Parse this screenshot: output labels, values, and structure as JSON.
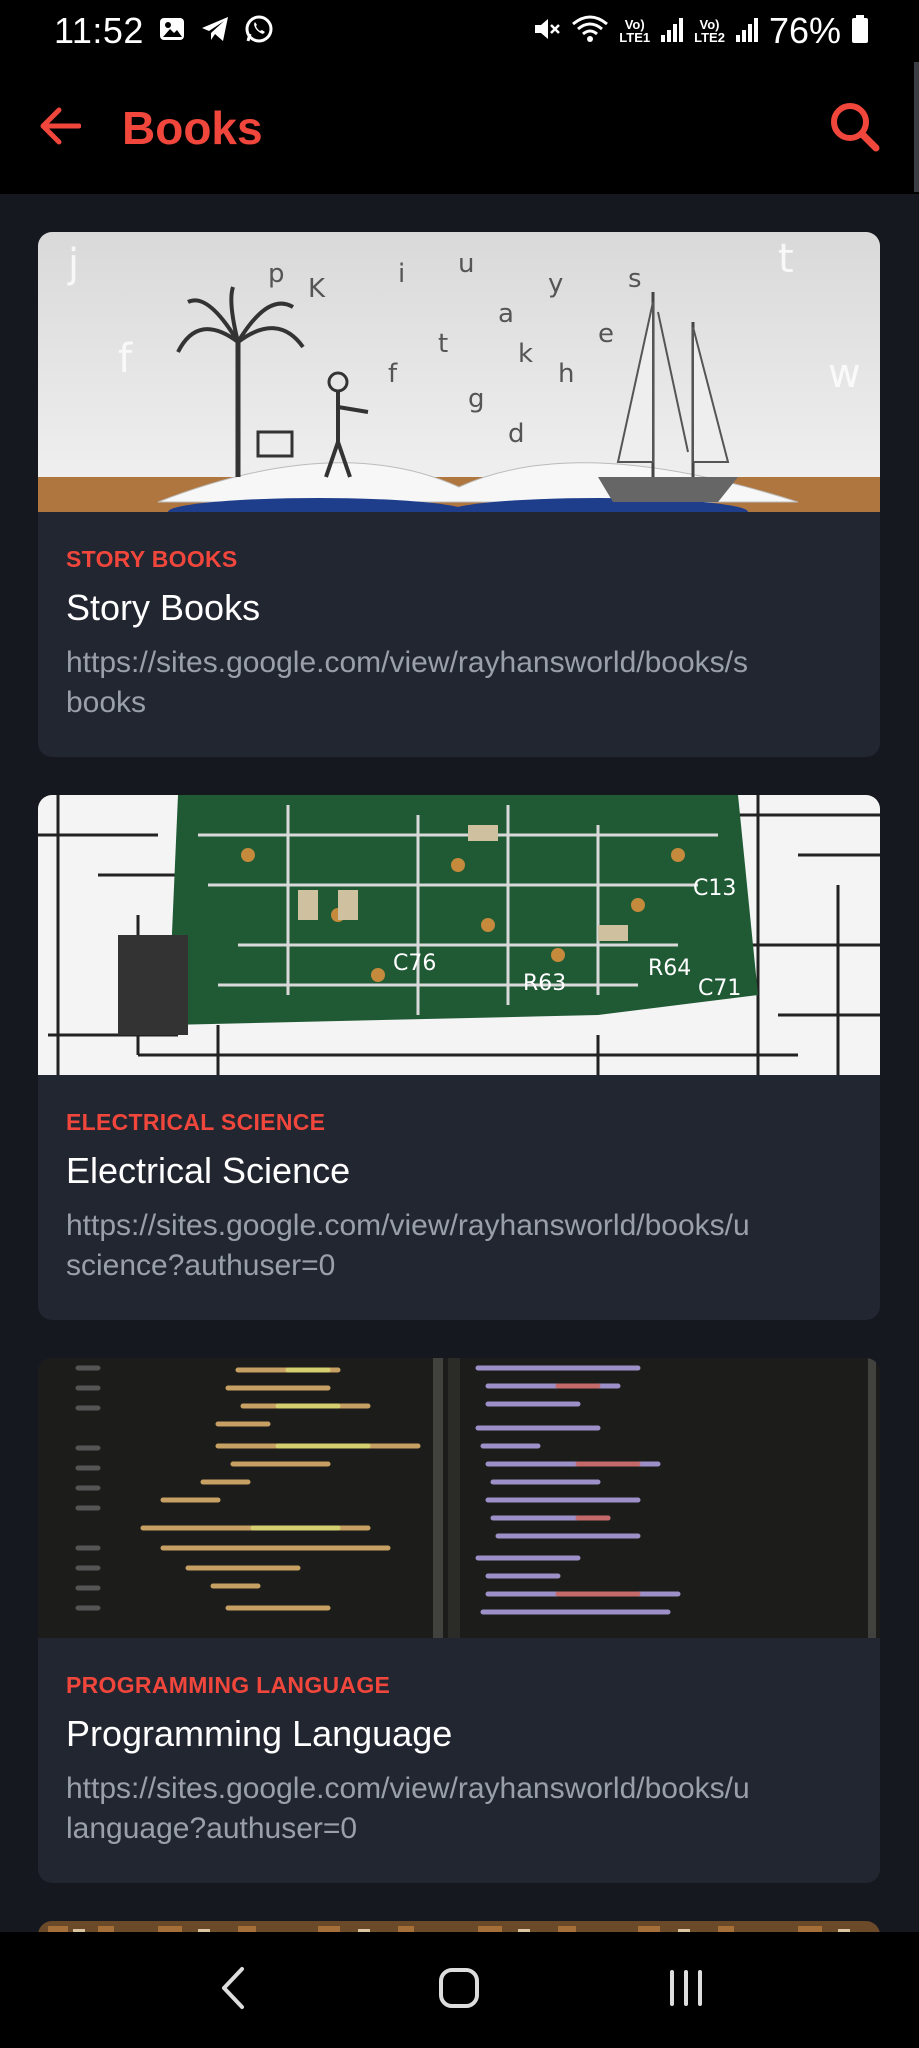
{
  "status": {
    "time": "11:52",
    "battery": "76%",
    "net1": [
      "Vo)",
      "LTE1"
    ],
    "net2": [
      "Vo)",
      "LTE2"
    ]
  },
  "app_bar": {
    "title": "Books"
  },
  "cards": [
    {
      "category": "STORY BOOKS",
      "title": "Story Books",
      "url": "https://sites.google.com/view/rayhansworld/books/s\nbooks"
    },
    {
      "category": "ELECTRICAL SCIENCE",
      "title": "Electrical Science",
      "url": "https://sites.google.com/view/rayhansworld/books/u\nscience?authuser=0"
    },
    {
      "category": "PROGRAMMING LANGUAGE",
      "title": "Programming Language",
      "url": "https://sites.google.com/view/rayhansworld/books/u\nlanguage?authuser=0"
    }
  ],
  "colors": {
    "accent": "#f0463c",
    "background": "#15181f",
    "card": "#222631",
    "url_text": "#9aa0aa"
  },
  "icons": {
    "back": "arrow-left-icon",
    "search": "search-icon",
    "nav_back": "chevron-left-icon",
    "nav_home": "home-icon",
    "nav_recents": "recents-icon"
  }
}
